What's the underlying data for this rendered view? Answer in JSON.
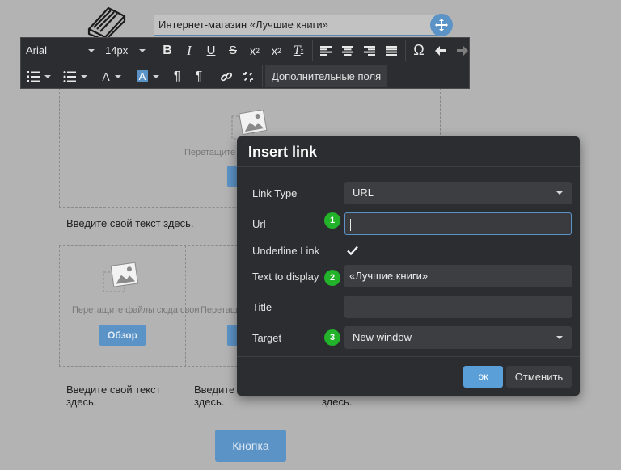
{
  "page": {
    "title_value": "Интернет-магазин «Лучшие книги»",
    "drop_hint": "Перетащите",
    "drop_hint_overlap": "Перетащите файлы сюда свои",
    "drop_hint_short": "Перетащите",
    "browse_label": "Обзор",
    "body_text": "Введите свой текст здесь.",
    "col_text_line1": "Введите свой текст",
    "col_text_line2": "здесь.",
    "col2_text_line1": "Введите",
    "col2_text_line2": "здесь.",
    "col3_text_line2": "здесь.",
    "button_label": "Кнопка"
  },
  "toolbar": {
    "font_family": "Arial",
    "font_size": "14px",
    "extra_fields_label": "Дополнительные поля",
    "icons": [
      "bold-icon",
      "italic-icon",
      "underline-icon",
      "strikethrough-icon",
      "superscript-icon",
      "subscript-icon",
      "clear-format-icon",
      "align-left-icon",
      "align-center-icon",
      "align-right-icon",
      "align-justify-icon",
      "omega-icon",
      "undo-icon",
      "redo-icon",
      "ordered-list-icon",
      "unordered-list-icon",
      "text-color-icon",
      "background-color-icon",
      "ltr-icon",
      "rtl-icon",
      "link-icon",
      "unlink-icon"
    ]
  },
  "dialog": {
    "title": "Insert link",
    "link_type_label": "Link Type",
    "link_type_value": "URL",
    "url_label": "Url",
    "url_value": "",
    "underline_label": "Underline Link",
    "underline_checked": true,
    "text_to_display_label": "Text to display",
    "text_to_display_value": "«Лучшие книги»",
    "title_label": "Title",
    "title_value": "",
    "target_label": "Target",
    "target_value": "New window",
    "ok_label": "ок",
    "cancel_label": "Отменить",
    "badges": [
      "1",
      "2",
      "3"
    ],
    "badge_color": "#22b32a",
    "accent_color": "#5b93c7"
  }
}
